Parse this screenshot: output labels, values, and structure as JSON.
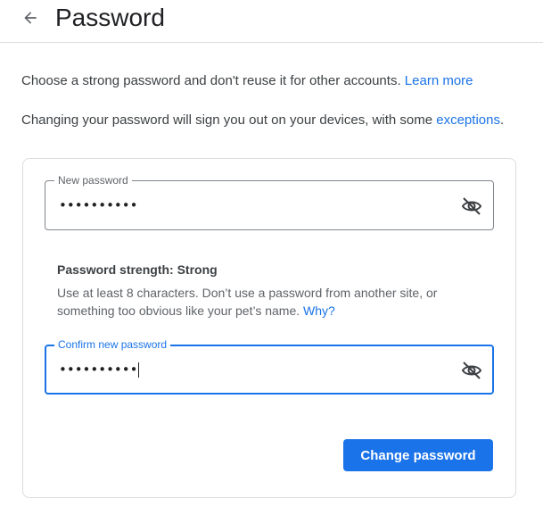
{
  "header": {
    "title": "Password",
    "back_icon": "arrow-left-icon"
  },
  "info": {
    "line1": "Choose a strong password and don't reuse it for other accounts.",
    "line1_link": "Learn more",
    "line2": "Changing your password will sign you out on your devices, with some",
    "line2_link": "exceptions",
    "line2_end": "."
  },
  "form": {
    "new_password": {
      "label": "New password",
      "value": "••••••••••",
      "toggle_icon": "eye-off-icon"
    },
    "strength": {
      "text": "Password strength: Strong"
    },
    "hint": {
      "text": "Use at least 8 characters. Don’t use a password from another site, or something too obvious like your pet’s name.",
      "link": "Why?"
    },
    "confirm_password": {
      "label": "Confirm new password",
      "value": "••••••••••",
      "toggle_icon": "eye-off-icon",
      "focused": true
    },
    "submit_label": "Change password"
  },
  "colors": {
    "accent": "#1a73e8",
    "border": "#dadce0",
    "text": "#202124",
    "muted": "#5f6368"
  }
}
